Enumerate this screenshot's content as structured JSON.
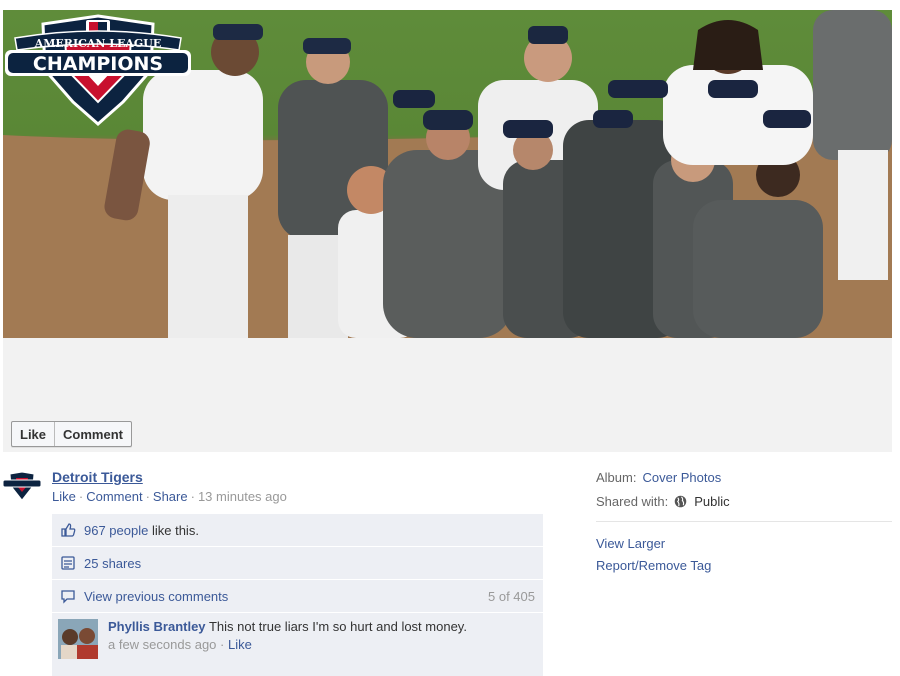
{
  "photo": {
    "alt": "Detroit Tigers celebrating on the field",
    "logo_top_text": "AMERICAN LEAGUE",
    "logo_main_text": "CHAMPIONS"
  },
  "actions": {
    "like_label": "Like",
    "comment_label": "Comment"
  },
  "post": {
    "poster": "Detroit Tigers",
    "meta_like": "Like",
    "meta_comment": "Comment",
    "meta_share": "Share",
    "timestamp": "13 minutes ago",
    "likes_count_link": "967 people",
    "likes_suffix": "like this.",
    "shares_text": "25 shares",
    "view_previous": "View previous comments",
    "comment_count": "5 of 405",
    "comment": {
      "author": "Phyllis Brantley",
      "text": "This not true liars I'm so hurt and lost money.",
      "time": "a few seconds ago",
      "like_label": "Like"
    }
  },
  "sidebar": {
    "album_label": "Album:",
    "album_value": "Cover Photos",
    "shared_label": "Shared with:",
    "shared_value": "Public",
    "view_larger": "View Larger",
    "report_tag": "Report/Remove Tag"
  },
  "colors": {
    "link": "#3b5998",
    "ufi_bg": "#edeff4",
    "muted": "#999999"
  }
}
